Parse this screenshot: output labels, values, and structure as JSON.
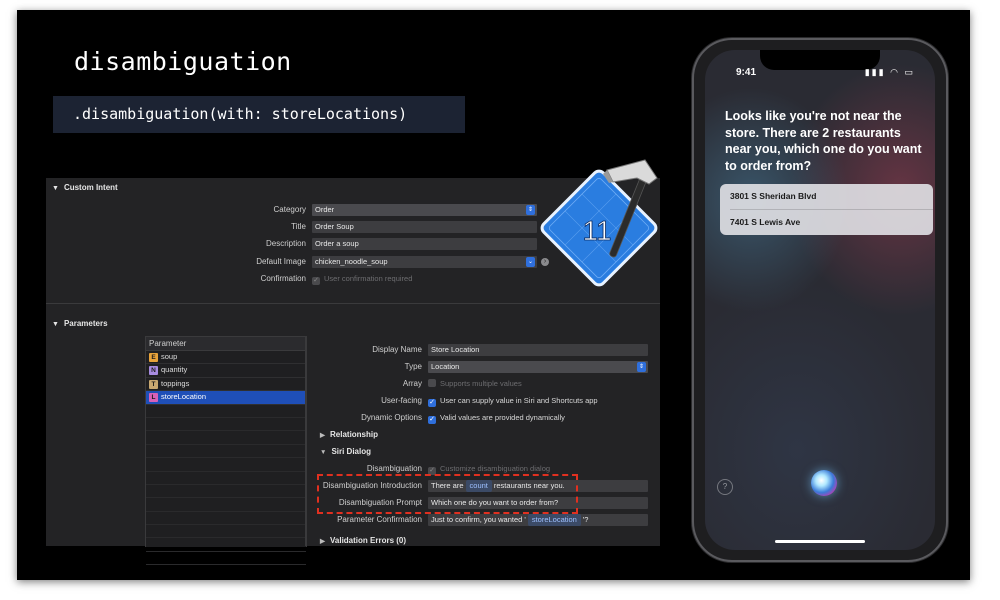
{
  "slide": {
    "title": "disambiguation",
    "code": ".disambiguation(with: storeLocations)"
  },
  "custom_intent": {
    "header": "Custom Intent",
    "category_label": "Category",
    "category_value": "Order",
    "title_label": "Title",
    "title_value": "Order Soup",
    "description_label": "Description",
    "description_value": "Order a soup",
    "default_image_label": "Default Image",
    "default_image_value": "chicken_noodle_soup",
    "confirmation_label": "Confirmation",
    "confirmation_text": "User confirmation required"
  },
  "parameters": {
    "header": "Parameters",
    "table_header": "Parameter",
    "items": [
      {
        "badge": "E",
        "name": "soup",
        "badge_color": "#e8a33a"
      },
      {
        "badge": "N",
        "name": "quantity",
        "badge_color": "#a78be0"
      },
      {
        "badge": "T",
        "name": "toppings",
        "badge_color": "#c9a870"
      },
      {
        "badge": "L",
        "name": "storeLocation",
        "badge_color": "#d861b8"
      }
    ]
  },
  "param_detail": {
    "display_name_label": "Display Name",
    "display_name_value": "Store Location",
    "type_label": "Type",
    "type_value": "Location",
    "array_label": "Array",
    "array_text": "Supports multiple values",
    "user_facing_label": "User-facing",
    "user_facing_text": "User can supply value in Siri and Shortcuts app",
    "dynamic_options_label": "Dynamic Options",
    "dynamic_options_text": "Valid values are provided dynamically",
    "relationship": "Relationship",
    "siri_dialog": "Siri Dialog",
    "disambiguation_label": "Disambiguation",
    "disambiguation_text": "Customize disambiguation dialog",
    "intro_label": "Disambiguation Introduction",
    "intro_pre": "There are",
    "intro_token": "count",
    "intro_post": "restaurants near you.",
    "prompt_label": "Disambiguation Prompt",
    "prompt_value": "Which one do you want to order from?",
    "confirm_label": "Parameter Confirmation",
    "confirm_pre": "Just to confirm, you wanted '",
    "confirm_token": "storeLocation",
    "confirm_post": "'?",
    "validation": "Validation Errors (0)"
  },
  "xcode_icon": {
    "version": "11"
  },
  "phone": {
    "time": "9:41",
    "siri_message": "Looks like you're not near the store. There are 2 restaurants near you, which one do you want to order from?",
    "options": [
      "3801 S Sheridan Blvd",
      "7401 S Lewis Ave"
    ],
    "help": "?"
  }
}
